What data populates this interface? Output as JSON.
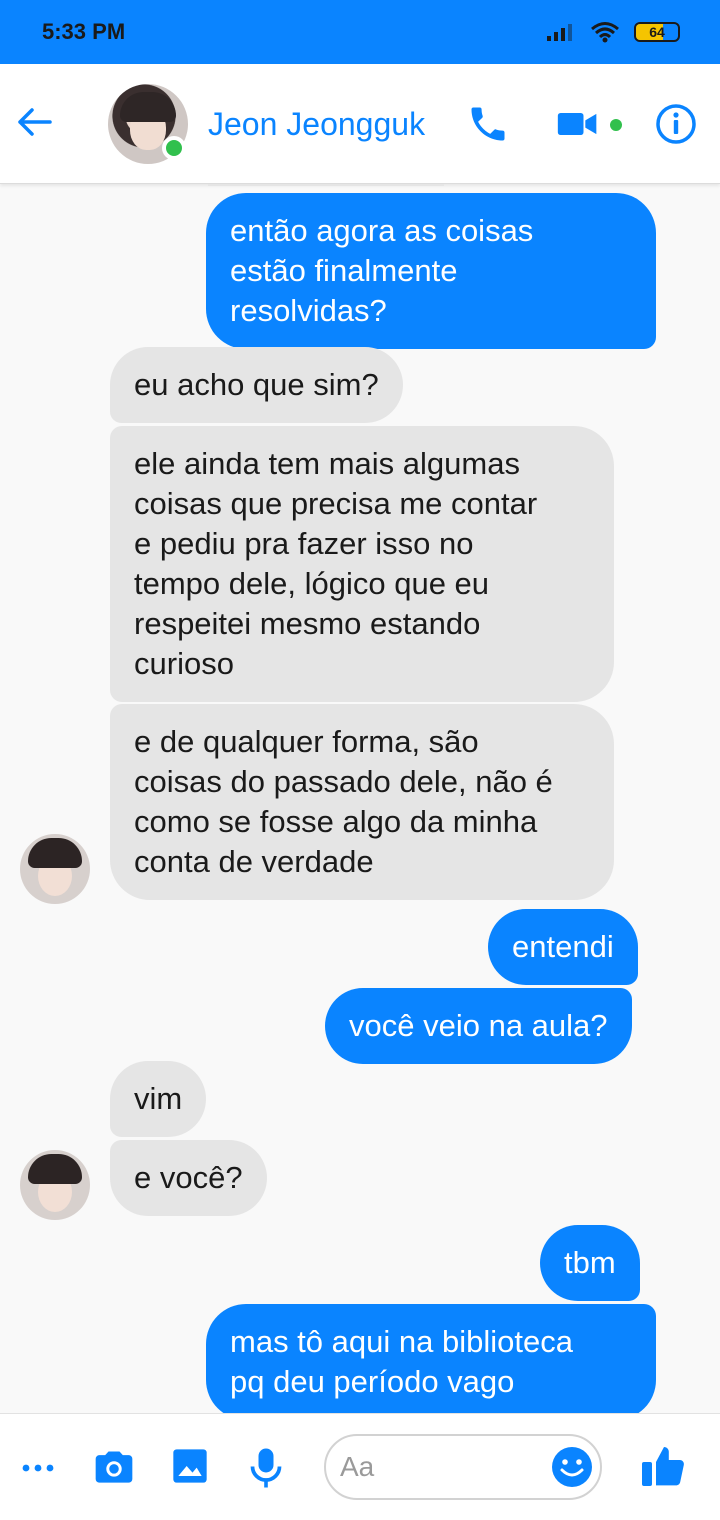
{
  "status_bar": {
    "time": "5:33 PM",
    "battery_level": "64",
    "bg_color": "#0a84ff"
  },
  "header": {
    "contact_name": "Jeon Jeongguk",
    "online": true,
    "icons": [
      "back-arrow-icon",
      "phone-icon",
      "video-camera-icon",
      "info-icon"
    ],
    "accent_color": "#0a84ff"
  },
  "messages": [
    {
      "direction": "sent",
      "text": "então agora as coisas\nestão finalmente\nresolvidas?"
    },
    {
      "direction": "received",
      "text": "eu acho que sim?"
    },
    {
      "direction": "received",
      "text": "ele ainda tem mais algumas\ncoisas que precisa me contar\ne pediu pra fazer isso no\ntempo dele, lógico que eu\nrespeitei mesmo estando\ncurioso"
    },
    {
      "direction": "received",
      "text": "e de qualquer forma, são\ncoisas do passado dele, não é\ncomo se fosse algo da minha\nconta de verdade"
    },
    {
      "direction": "sent",
      "text": "entendi"
    },
    {
      "direction": "sent",
      "text": "você veio na aula?"
    },
    {
      "direction": "received",
      "text": "vim"
    },
    {
      "direction": "received",
      "text": "e você?"
    },
    {
      "direction": "sent",
      "text": "tbm"
    },
    {
      "direction": "sent",
      "text": "mas tô aqui na biblioteca\npq deu período vago"
    }
  ],
  "composer": {
    "placeholder": "Aa",
    "icons": [
      "more-icon",
      "camera-icon",
      "gallery-icon",
      "microphone-icon",
      "emoji-icon",
      "thumbs-up-icon"
    ]
  },
  "colors": {
    "sent_bubble": "#0a84ff",
    "received_bubble": "#e5e5e5",
    "online_dot": "#31c04d"
  }
}
